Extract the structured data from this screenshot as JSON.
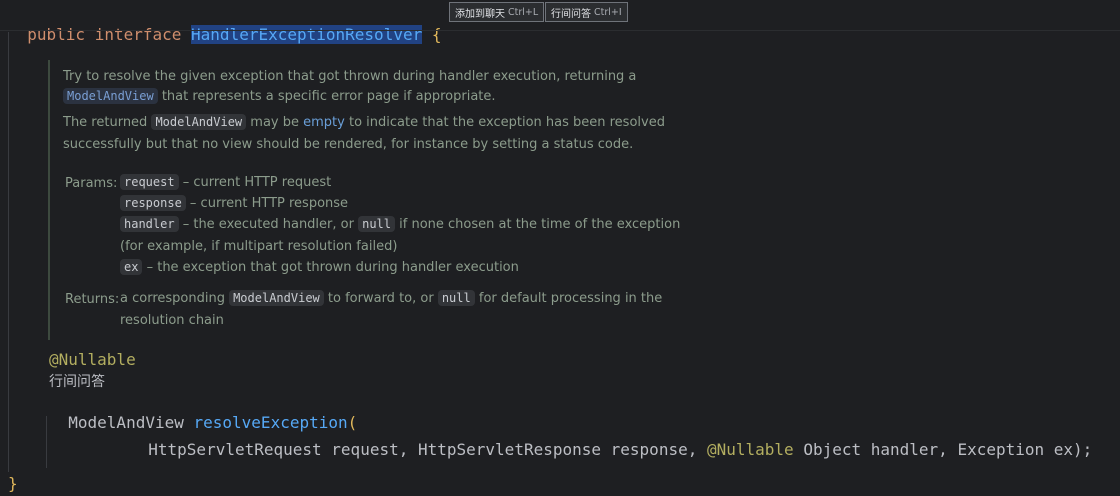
{
  "code": {
    "line1": {
      "kw": "public interface ",
      "class_name": "HandlerExceptionResolver",
      "brace_open": " {"
    },
    "annotation": "@Nullable",
    "inlay_hint": "行间问答",
    "method_return": "ModelAndView ",
    "method_name": "resolveException",
    "paren_open": "(",
    "param1_type": "HttpServletRequest",
    "param1_name": " request, ",
    "param2_type": "HttpServletResponse",
    "param2_name": " response, ",
    "param3_ann": "@Nullable",
    "param3_rest": " Object handler, Exception ex);",
    "brace_close": "}"
  },
  "hint_buttons": [
    {
      "label": "添加到聊天",
      "shortcut": "Ctrl+L"
    },
    {
      "label": "行间问答",
      "shortcut": "Ctrl+I"
    }
  ],
  "doc": {
    "p1_a": "Try to resolve the given exception that got thrown during handler execution, returning a",
    "p1_chip": "ModelAndView",
    "p1_b": " that represents a specific error page if appropriate.",
    "p2_a": "The returned ",
    "p2_chip": "ModelAndView",
    "p2_b": " may be ",
    "p2_link": "empty",
    "p2_c": " to indicate that the exception has been resolved",
    "p2_d": "successfully but that no view should be rendered, for instance by setting a status code.",
    "params_label": "Params:",
    "params": [
      {
        "name": "request",
        "desc": " – current HTTP request"
      },
      {
        "name": "response",
        "desc": " – current HTTP response"
      },
      {
        "name": "handler",
        "desc": " – the executed handler, or ",
        "chip2": "null",
        "desc2": " if none chosen at the time of the exception"
      },
      {
        "name": "ex",
        "desc": " – the exception that got thrown during handler execution"
      }
    ],
    "handler_cont": "(for example, if multipart resolution failed)",
    "returns_label": "Returns:",
    "returns_a": "a corresponding ",
    "returns_chip": "ModelAndView",
    "returns_b": " to forward to, or ",
    "returns_chip2": "null",
    "returns_c": " for default processing in the",
    "returns_d": "resolution chain"
  },
  "colors": {
    "background": "#1e1f22",
    "keyword": "#cf8e6d",
    "annotation": "#b3ae60",
    "method": "#56a8f5",
    "brace": "#e0b75b",
    "doc_text": "#8c9c8c"
  }
}
